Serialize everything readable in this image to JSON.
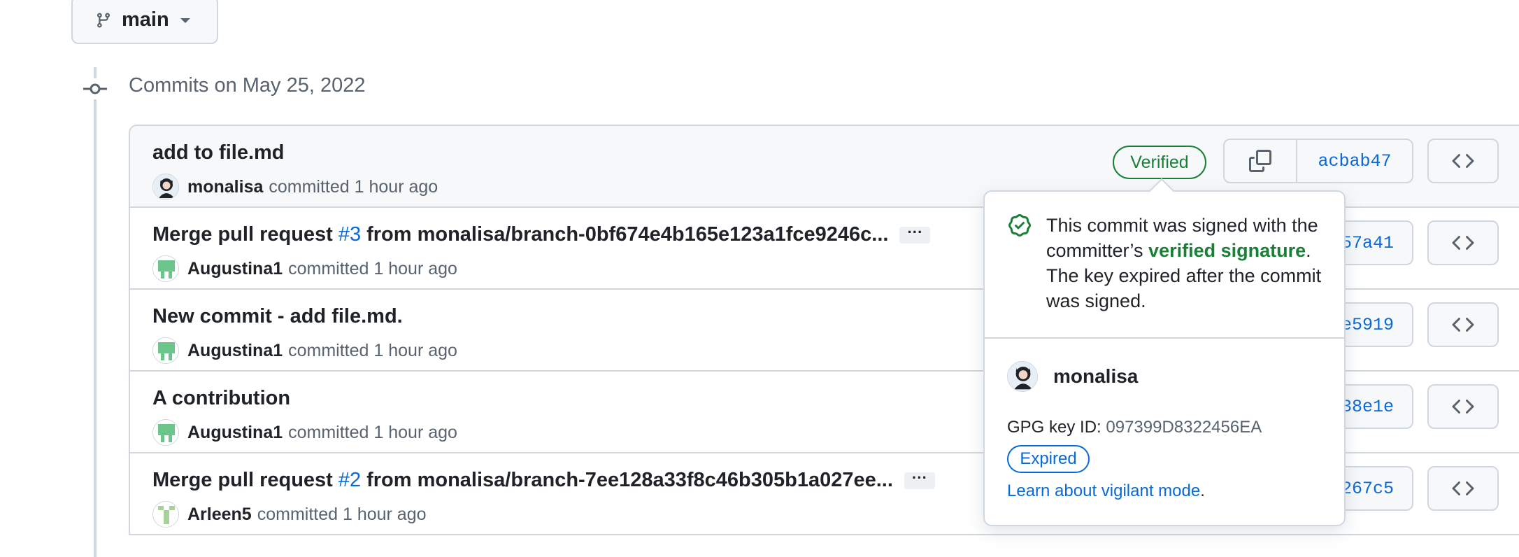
{
  "branch": {
    "name": "main",
    "icon": "git-branch-icon",
    "caret": "triangle-down-icon"
  },
  "timeline": {
    "date_heading": "Commits on May 25, 2022",
    "icon": "git-commit-icon"
  },
  "commits": [
    {
      "title": "add to file.md",
      "author": "monalisa",
      "committed_text": "committed 1 hour ago",
      "sha": "acbab47",
      "verified": "Verified"
    },
    {
      "title_prefix": "Merge pull request",
      "pr_number": "#3",
      "title_suffix": "from monalisa/branch-0bf674e4b165e123a1fce9246c...",
      "author": "Augustina1",
      "committed_text": "committed 1 hour ago",
      "sha_partial": "57a41",
      "ellipsis": "···"
    },
    {
      "title": "New commit - add file.md.",
      "author": "Augustina1",
      "committed_text": "committed 1 hour ago",
      "sha_partial": "e5919"
    },
    {
      "title": "A contribution",
      "author": "Augustina1",
      "committed_text": "committed 1 hour ago",
      "sha_partial": "38e1e"
    },
    {
      "title_prefix": "Merge pull request",
      "pr_number": "#2",
      "title_suffix": "from monalisa/branch-7ee128a33f8c46b305b1a027ee...",
      "author": "Arleen5",
      "committed_text": "committed 1 hour ago",
      "sha_partial": "267c5",
      "ellipsis": "···"
    }
  ],
  "popover": {
    "message_before": "This commit was signed with the committer’s",
    "message_highlight": "verified signature",
    "message_after": ". The key expired after the commit was signed.",
    "user": "monalisa",
    "gpg_label": "GPG key ID:",
    "gpg_key": "097399D8322456EA",
    "status_badge": "Expired",
    "learn_link": "Learn about vigilant mode",
    "learn_period": "."
  },
  "colors": {
    "accent": "#0969da",
    "success": "#1a7f37",
    "border": "#d0d7de",
    "muted": "#59636e"
  }
}
